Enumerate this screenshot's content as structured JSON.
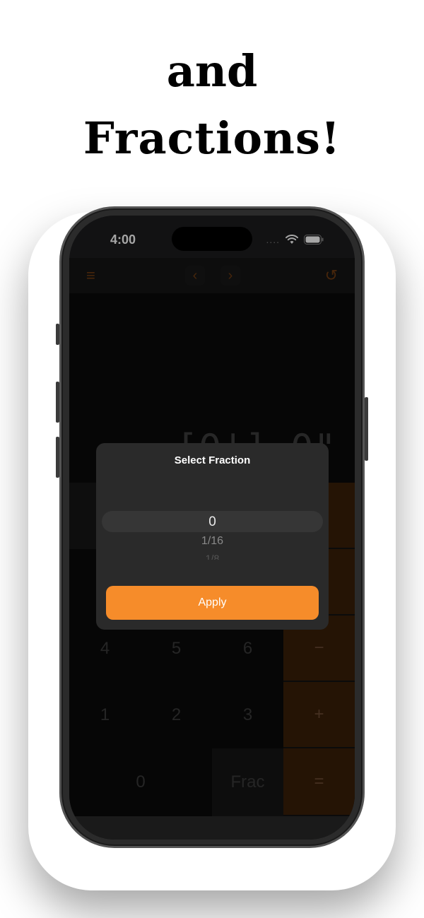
{
  "headline": {
    "line1": "and",
    "line2": "Fractions!"
  },
  "status_bar": {
    "time": "4:00",
    "dots": "....",
    "wifi_icon": "wifi-icon",
    "battery_icon": "battery-icon"
  },
  "toolbar": {
    "menu_icon": "≡",
    "back_icon": "‹",
    "forward_icon": "›",
    "history_icon": "↺"
  },
  "display": {
    "value": "[0'] 0\""
  },
  "keypad": {
    "row4": [
      "4",
      "5",
      "6",
      "−"
    ],
    "row5": [
      "1",
      "2",
      "3",
      "+"
    ],
    "row6": [
      "0",
      "Frac",
      "="
    ]
  },
  "dialog": {
    "title": "Select Fraction",
    "options": [
      "0",
      "1/16",
      "1/8"
    ],
    "selected": "0",
    "apply_label": "Apply"
  },
  "colors": {
    "accent": "#f68c2a",
    "background": "#0a0a0a",
    "dialog": "#2a2a2a"
  }
}
